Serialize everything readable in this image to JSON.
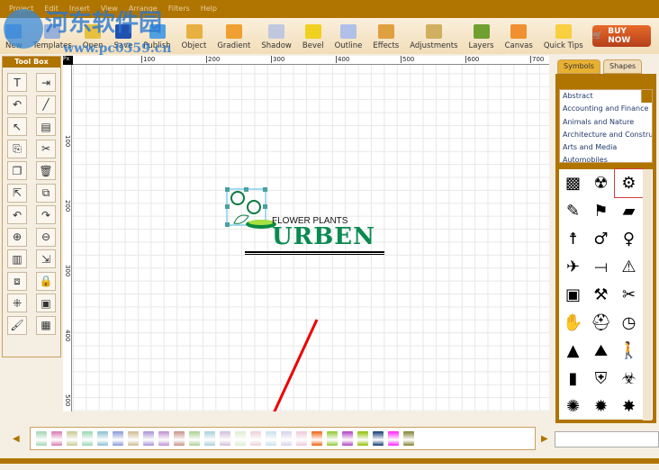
{
  "menu": [
    "Project",
    "Edit",
    "Insert",
    "View",
    "Arrange",
    "Filters",
    "Help"
  ],
  "toolbar": [
    {
      "label": "New",
      "color": "#6aa0e0"
    },
    {
      "label": "Templates",
      "color": "#9ab0d8"
    },
    {
      "label": "Open",
      "color": "#e8c040"
    },
    {
      "label": "Save",
      "color": "#2050b0"
    },
    {
      "label": "Publish",
      "color": "#50a0e0"
    },
    {
      "label": "Object",
      "color": "#e8b040"
    },
    {
      "label": "Gradient",
      "color": "#f0a030"
    },
    {
      "label": "Shadow",
      "color": "#c0c8e0"
    },
    {
      "label": "Bevel",
      "color": "#f0d020"
    },
    {
      "label": "Outline",
      "color": "#b0c0e8"
    },
    {
      "label": "Effects",
      "color": "#e0a040"
    },
    {
      "label": "Adjustments",
      "color": "#d0b060"
    },
    {
      "label": "Layers",
      "color": "#70a030"
    },
    {
      "label": "Canvas",
      "color": "#f09030"
    },
    {
      "label": "Quick Tips",
      "color": "#f8d040"
    }
  ],
  "buy_now": "BUY NOW",
  "watermark": {
    "name": "河东软件园",
    "url": "www.pc0359.cn"
  },
  "toolbox": {
    "title": "Tool Box",
    "tools": [
      "T",
      "⇥",
      "↶",
      "╱",
      "↖",
      "▤",
      "⎘",
      "✂",
      "❐",
      "🗑",
      "⇱",
      "⧉",
      "↶",
      "↷",
      "⊕",
      "⊖",
      "▥",
      "⇲",
      "⧈",
      "🔒",
      "⁜",
      "▣",
      "🖌",
      "▦"
    ]
  },
  "ruler": {
    "unit": "Px",
    "top": [
      "100",
      "200",
      "300",
      "400",
      "500",
      "600",
      "700"
    ],
    "left": [
      "100",
      "200",
      "300",
      "400",
      "500"
    ]
  },
  "logo": {
    "tagline": "FLOWER PLANTS",
    "name": "URBEN"
  },
  "panel": {
    "tabs": [
      "Symbols",
      "Shapes"
    ],
    "categories": [
      "Abstract",
      "Accounting and Finance",
      "Animals and Nature",
      "Architecture and Construction",
      "Arts and Media",
      "Automobiles"
    ],
    "symbols": [
      "▩",
      "☢",
      "⚙",
      "✎",
      "⚑",
      "▰",
      "☨",
      "♂",
      "♀",
      "✈",
      "⟞",
      "⚠",
      "▣",
      "⚒",
      "✂",
      "✋",
      "⛑",
      "◷",
      "▲",
      "⛰",
      "🚶",
      "▮",
      "⛨",
      "☣",
      "✺",
      "✹",
      "✸"
    ]
  },
  "swatches": [
    "#9fd4b0",
    "#d878b0",
    "#c8c890",
    "#98d4b0",
    "#88c0d0",
    "#8898d8",
    "#d0b890",
    "#a890d8",
    "#c090d0",
    "#c89088",
    "#a8d090",
    "#a8d0d8",
    "#d0c0d8",
    "#e0ecd0",
    "#ecd0d8",
    "#c8e0ec",
    "#d8d0ec",
    "#ecc8d8",
    "#f06010",
    "#90c830",
    "#b040c0",
    "#90c000",
    "#103870",
    "#ff20ff",
    "#808030"
  ]
}
